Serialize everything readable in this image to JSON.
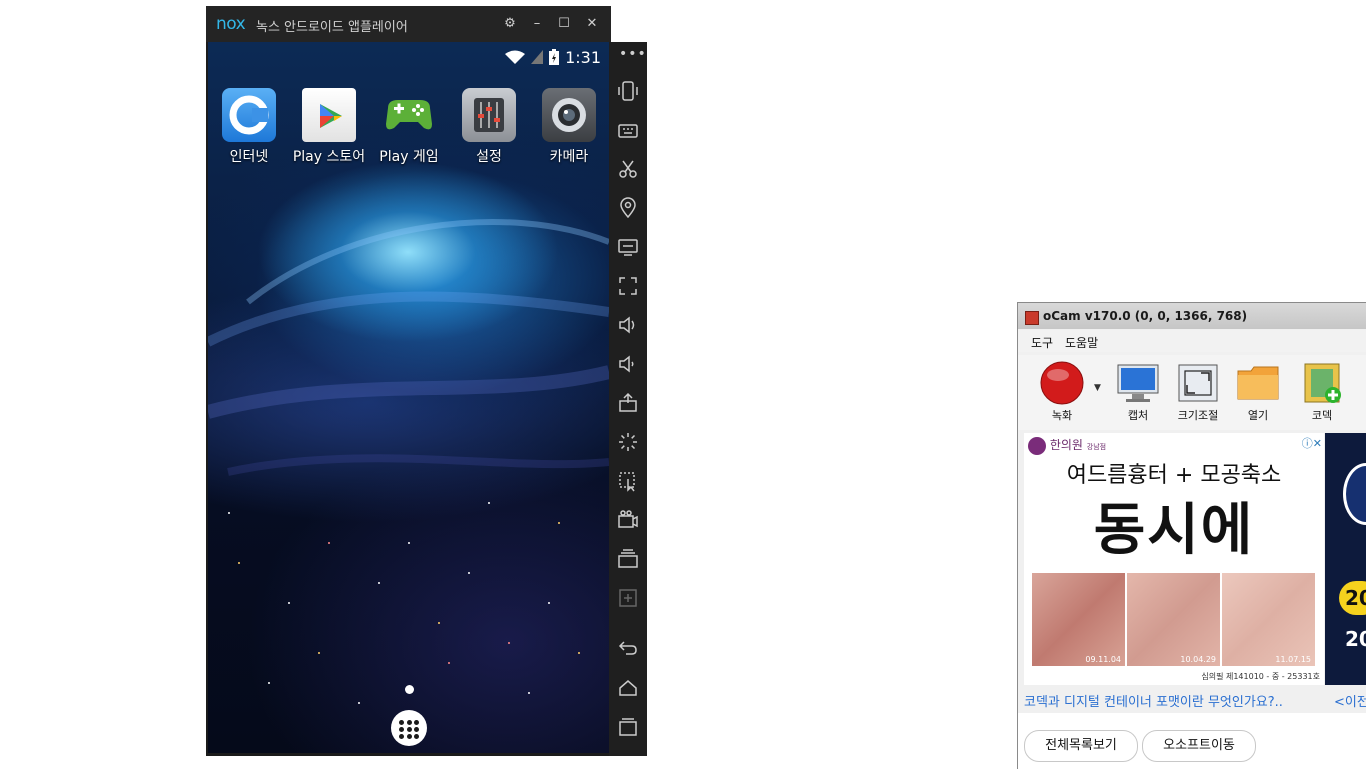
{
  "nox": {
    "logo": "nox",
    "title": "녹스 안드로이드 앱플레이어",
    "titlebar_buttons": {
      "settings": "⚙",
      "minimize": "–",
      "maximize": "☐",
      "close": "✕"
    },
    "status_time": "1:31",
    "apps": [
      {
        "label": "인터넷",
        "icon": "browser-icon"
      },
      {
        "label": "Play 스토어",
        "icon": "play-store-icon"
      },
      {
        "label": "Play 게임",
        "icon": "play-games-icon"
      },
      {
        "label": "설정",
        "icon": "settings-icon"
      },
      {
        "label": "카메라",
        "icon": "camera-icon"
      }
    ],
    "sidebar": {
      "more": "•••",
      "buttons": [
        "shake-icon",
        "keyboard-icon",
        "scissors-icon",
        "location-icon",
        "screen-icon",
        "fullscreen-icon",
        "volume-up-icon",
        "volume-down-icon",
        "apk-install-icon",
        "loading-icon",
        "macro-icon",
        "video-record-icon",
        "multi-instance-icon",
        "screenshot-icon",
        "back-icon",
        "home-icon",
        "recent-apps-icon"
      ]
    }
  },
  "ocam": {
    "title": "oCam v170.0 (0, 0, 1366, 768)",
    "menu": [
      "도구",
      "도움말"
    ],
    "toolbar": [
      {
        "label": "녹화",
        "icon": "record-icon"
      },
      {
        "label": "캡처",
        "icon": "capture-icon"
      },
      {
        "label": "크기조절",
        "icon": "resize-icon"
      },
      {
        "label": "열기",
        "icon": "folder-icon"
      },
      {
        "label": "코덱",
        "icon": "codec-icon"
      }
    ],
    "ad": {
      "logo": "한의원",
      "logo_sub": "강남점",
      "headline": "여드름흉터 + 모공축소",
      "brand": "동시에",
      "dates": [
        "09.11.04",
        "10.04.29",
        "11.07.15"
      ],
      "footer": "심의필 제141010 - 중 - 25331호",
      "info": "ⓘ✕",
      "side_text_1": "20",
      "side_text_2": "20"
    },
    "link": "코덱과 디지털 컨테이너 포맷이란 무엇인가요?..",
    "link_prev": "<이전",
    "buttons": {
      "all_list": "전체목록보기",
      "osoft": "오소프트이동"
    }
  }
}
